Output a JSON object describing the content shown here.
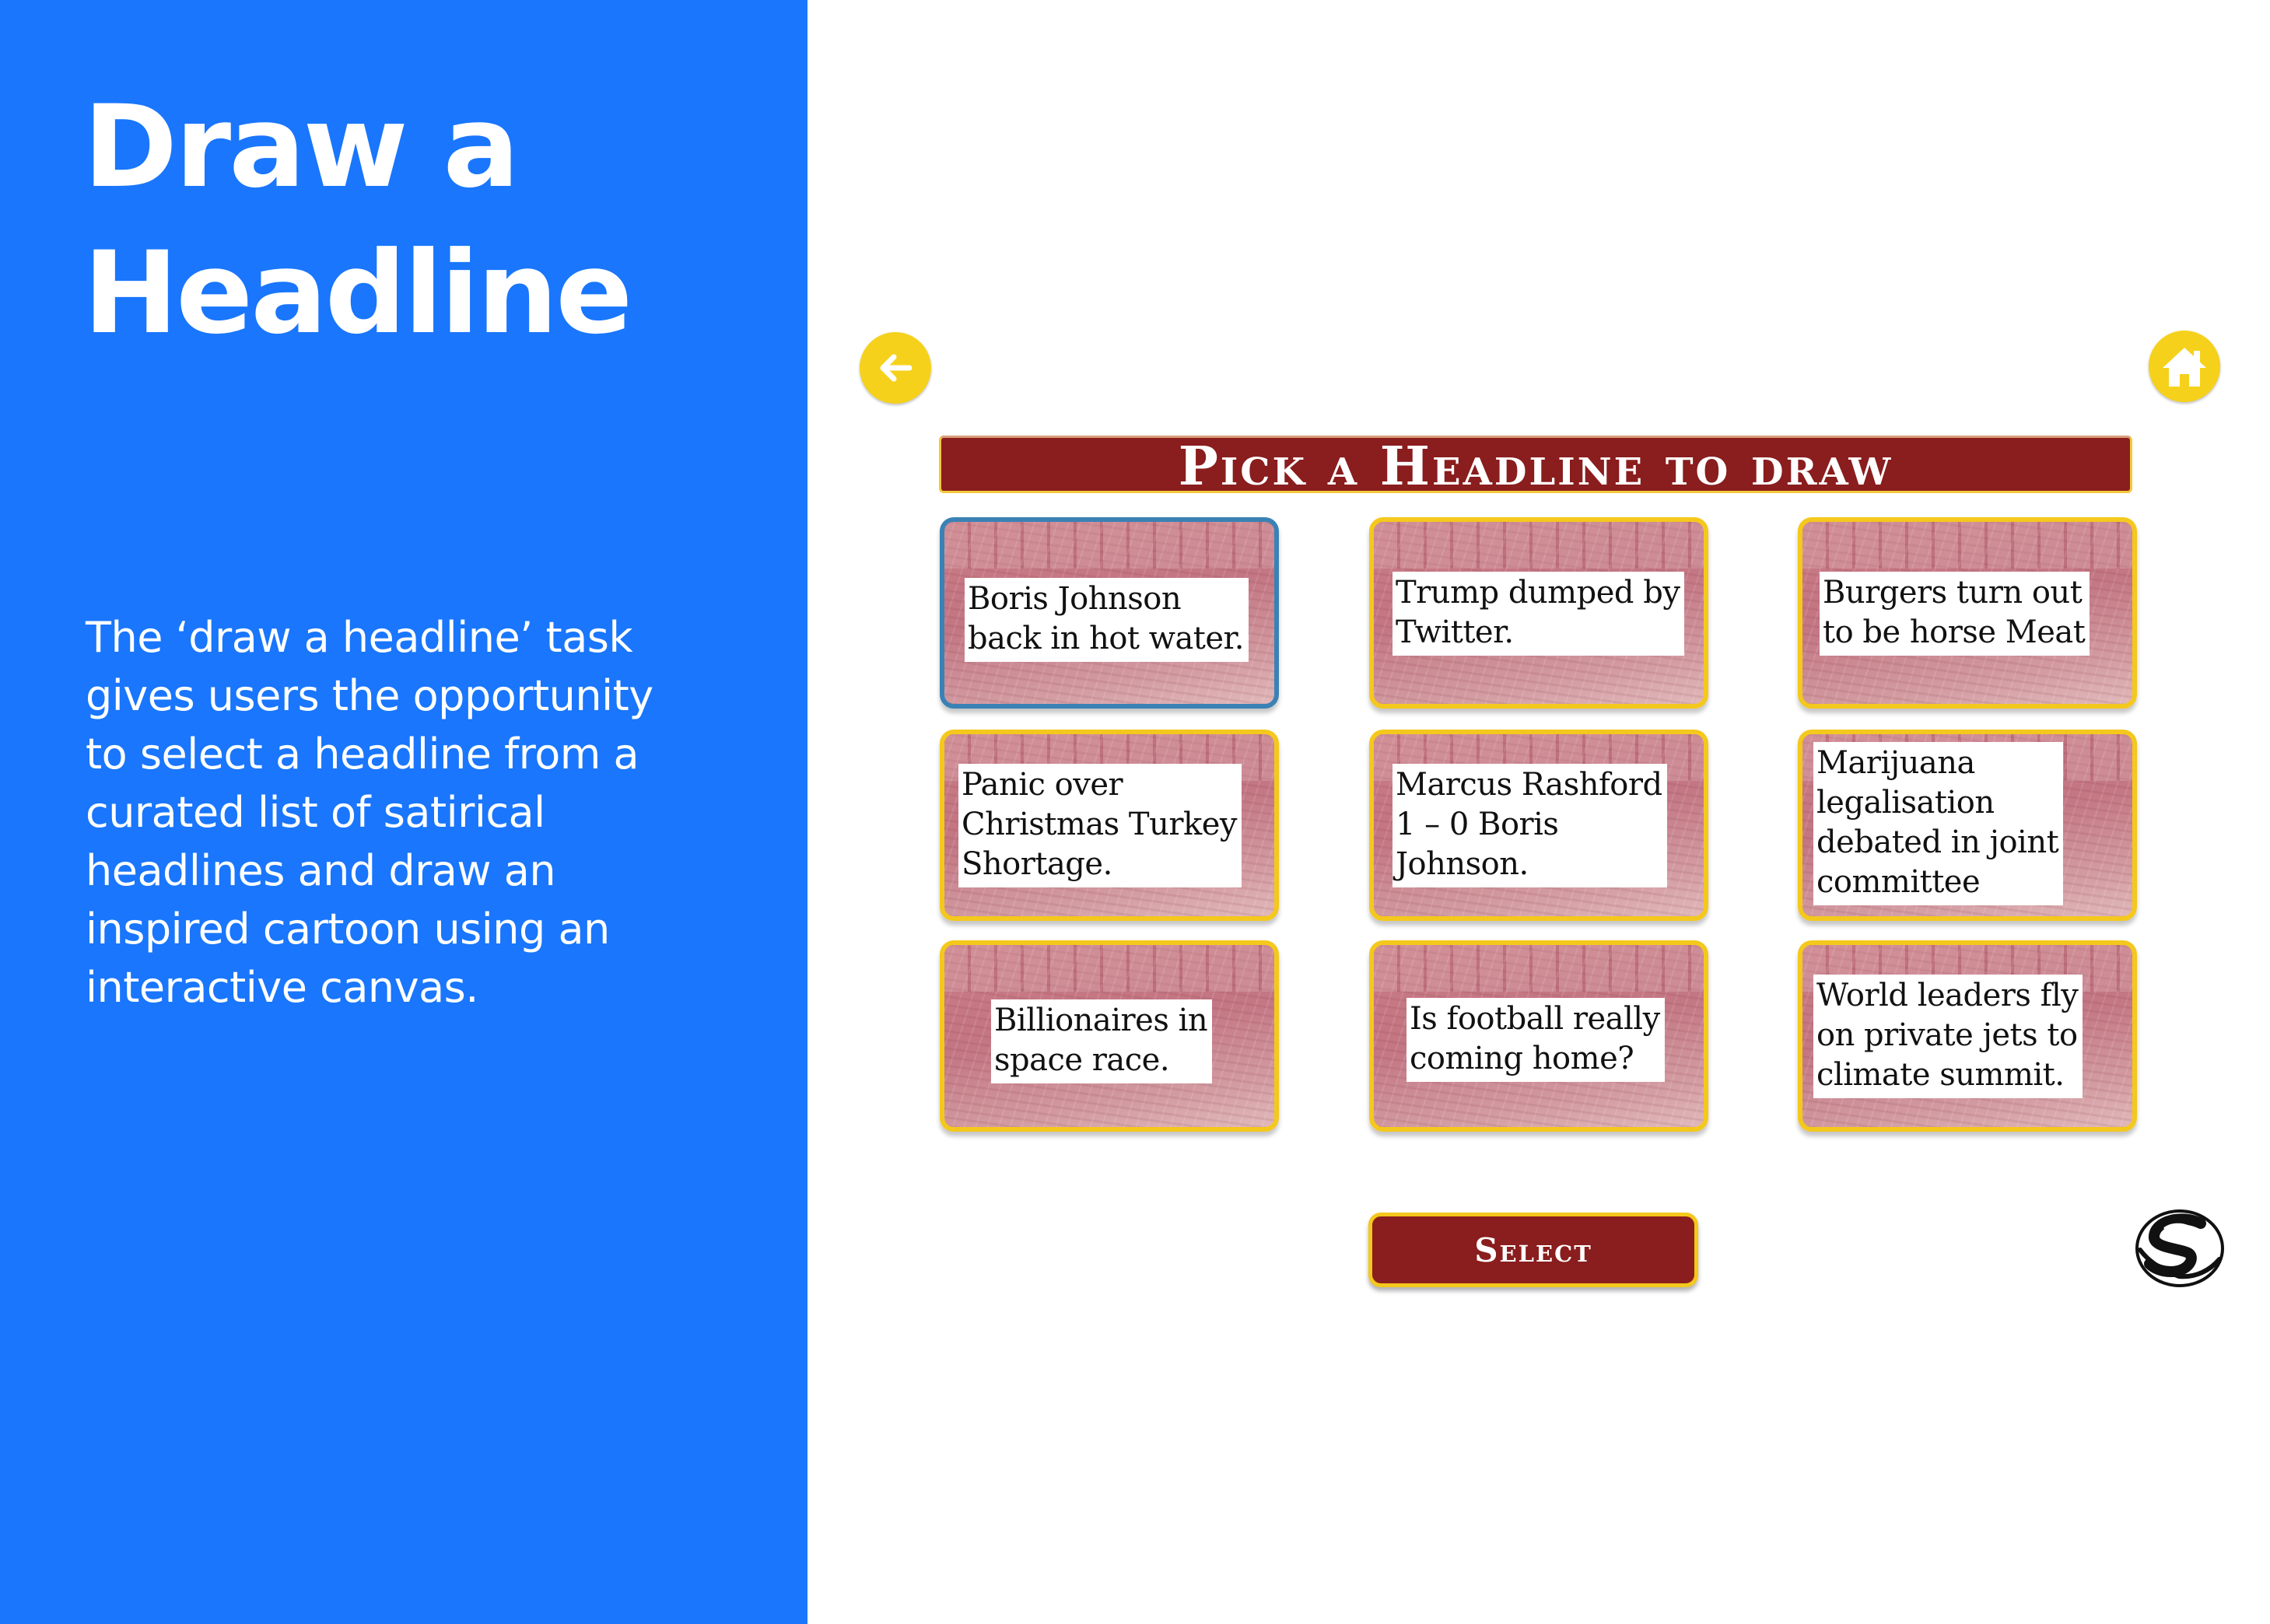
{
  "left_panel": {
    "title": "Draw a Headline",
    "description": "The ‘draw a headline’ task gives users the opportunity to select a headline from a curated list of satirical headlines and draw an inspired cartoon using an interactive canvas."
  },
  "app": {
    "nav": {
      "back_icon": "arrow-left-icon",
      "home_icon": "home-icon"
    },
    "banner_title": "Pick a Headline to draw",
    "headlines": [
      {
        "lines": [
          "Boris Johnson",
          "back in hot water."
        ],
        "selected": true
      },
      {
        "lines": [
          "Trump dumped by",
          "Twitter."
        ],
        "selected": false
      },
      {
        "lines": [
          "Burgers turn out",
          "to be horse Meat"
        ],
        "selected": false
      },
      {
        "lines": [
          "Panic over",
          "Christmas Turkey",
          "Shortage."
        ],
        "selected": false
      },
      {
        "lines": [
          "Marcus Rashford",
          "1 – 0 Boris",
          "Johnson."
        ],
        "selected": false
      },
      {
        "lines": [
          "Marijuana",
          "legalisation",
          "debated in joint",
          "committee"
        ],
        "selected": false
      },
      {
        "lines": [
          "Billionaires in",
          "space race."
        ],
        "selected": false
      },
      {
        "lines": [
          "Is football really",
          "coming home?"
        ],
        "selected": false
      },
      {
        "lines": [
          "World leaders fly",
          "on private jets to",
          "climate summit."
        ],
        "selected": false
      }
    ],
    "select_label": "Select",
    "logo_icon": "brand-logo-icon"
  },
  "colors": {
    "panel_blue": "#1976fd",
    "accent_yellow": "#f6d11b",
    "banner_red": "#8a1d1d",
    "selected_border": "#3a82b5"
  }
}
